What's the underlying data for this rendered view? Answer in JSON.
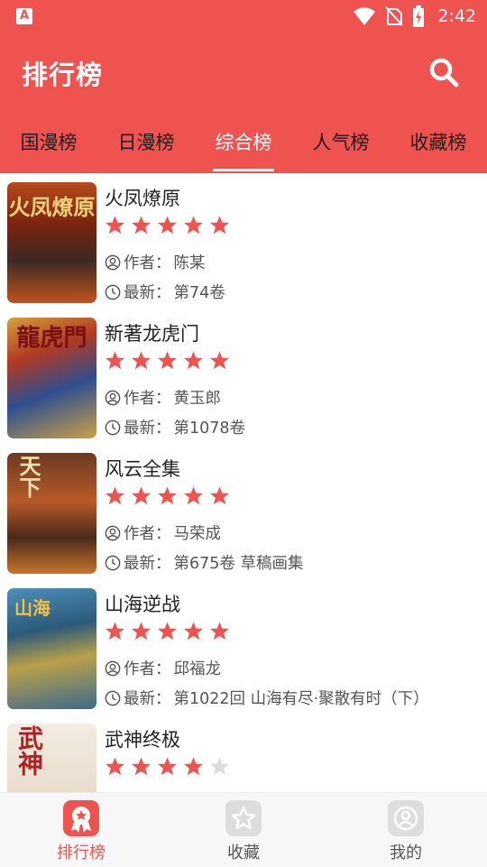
{
  "status_bar": {
    "time": "2:42",
    "app_icon_letter": "A",
    "icons": [
      "wifi-icon",
      "no-sim-icon",
      "battery-charging-icon"
    ]
  },
  "header": {
    "title": "排行榜",
    "search_icon": "search-icon"
  },
  "tabs": [
    {
      "label": "国漫榜",
      "active": false
    },
    {
      "label": "日漫榜",
      "active": false
    },
    {
      "label": "综合榜",
      "active": true
    },
    {
      "label": "人气榜",
      "active": false
    },
    {
      "label": "收藏榜",
      "active": false
    }
  ],
  "list": {
    "author_prefix": "作者：",
    "latest_prefix": "最新：",
    "items": [
      {
        "title": "火凤燎原",
        "rating": 5,
        "author": "陈某",
        "latest": "第74卷",
        "cover_text": "火凤燎原"
      },
      {
        "title": "新著龙虎门",
        "rating": 5,
        "author": "黄玉郎",
        "latest": "第1078卷",
        "cover_text": "龍虎門"
      },
      {
        "title": "风云全集",
        "rating": 5,
        "author": "马荣成",
        "latest": "第675卷 草稿画集",
        "cover_text": "天下"
      },
      {
        "title": "山海逆战",
        "rating": 5,
        "author": "邱福龙",
        "latest": "第1022回 山海有尽·聚散有时（下）",
        "cover_text": "山海"
      },
      {
        "title": "武神终极",
        "rating": 4,
        "cover_text": "武神"
      }
    ]
  },
  "bottom_nav": [
    {
      "label": "排行榜",
      "icon": "ranking-icon",
      "active": true
    },
    {
      "label": "收藏",
      "icon": "star-icon",
      "active": false
    },
    {
      "label": "我的",
      "icon": "profile-icon",
      "active": false
    }
  ],
  "colors": {
    "primary": "#ef5350",
    "star_active": "#ef5350",
    "star_inactive": "#dcdcdc",
    "nav_inactive_icon_bg": "#dddddd"
  }
}
